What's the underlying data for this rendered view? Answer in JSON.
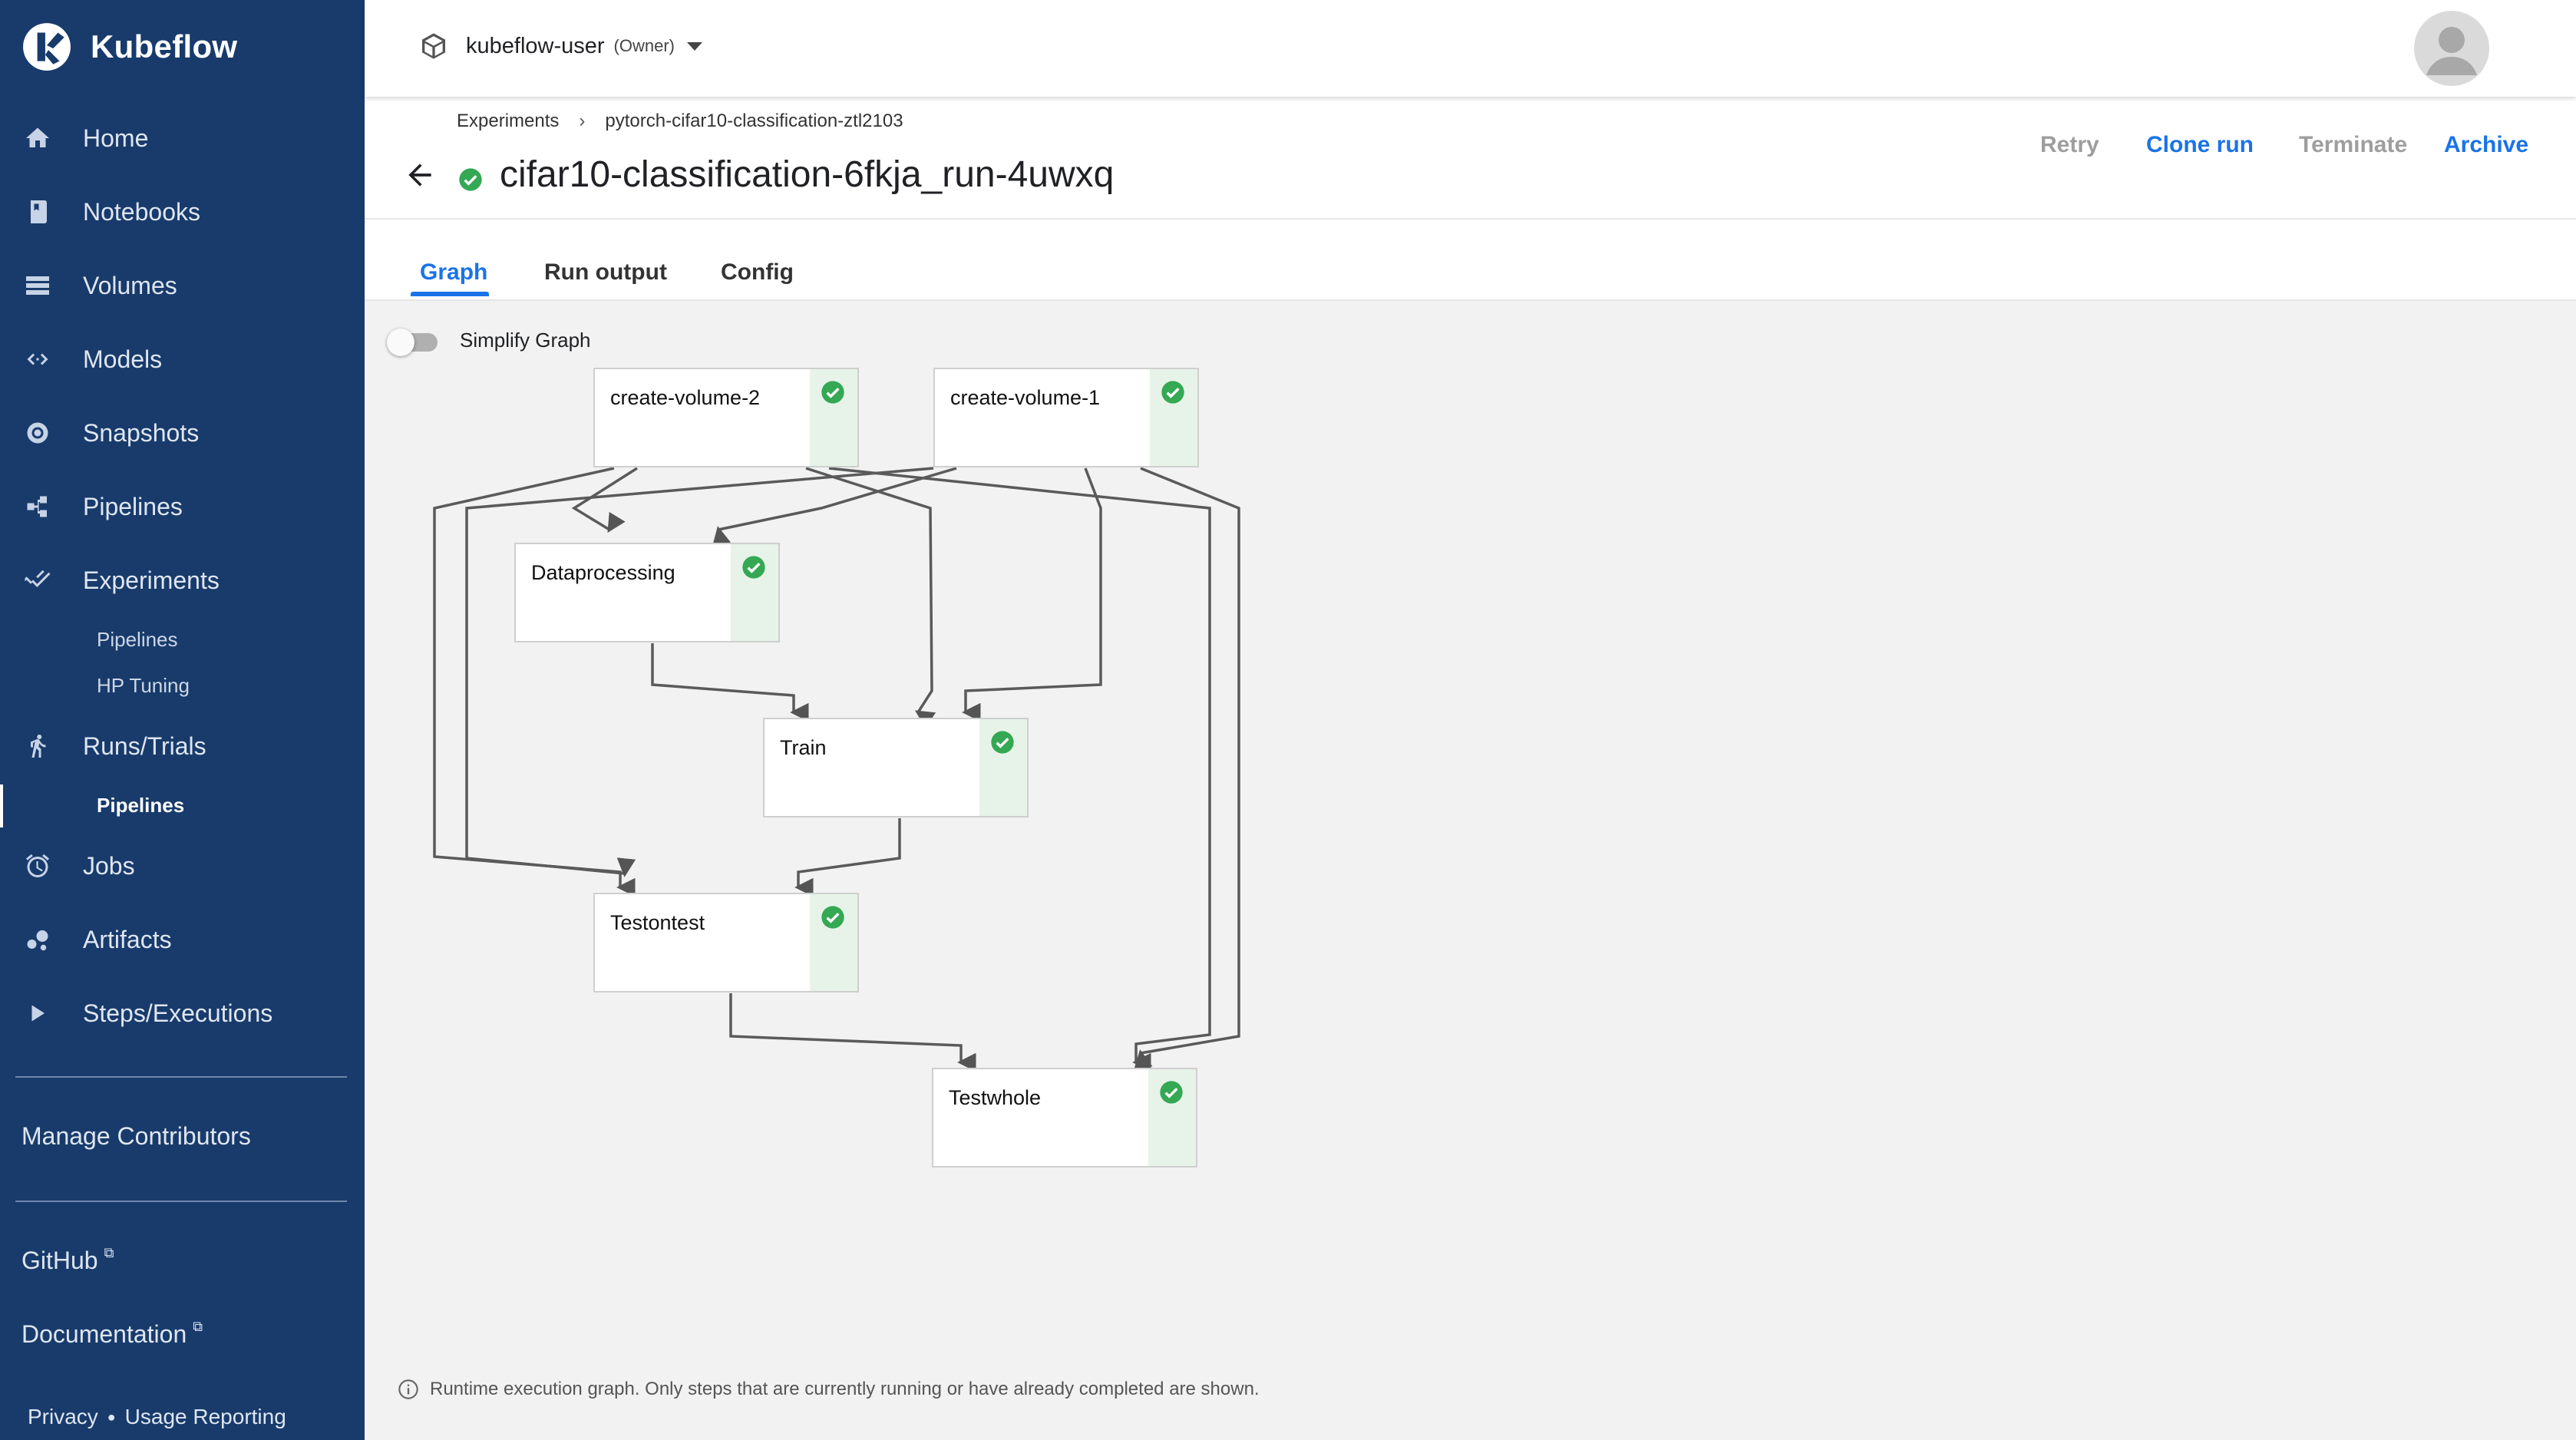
{
  "brand": {
    "name": "Kubeflow"
  },
  "sidebar": {
    "items": [
      {
        "label": "Home",
        "icon": "home-icon"
      },
      {
        "label": "Notebooks",
        "icon": "notebook-icon"
      },
      {
        "label": "Volumes",
        "icon": "volumes-icon"
      },
      {
        "label": "Models",
        "icon": "models-icon"
      },
      {
        "label": "Snapshots",
        "icon": "snapshots-icon"
      },
      {
        "label": "Pipelines",
        "icon": "pipelines-icon"
      },
      {
        "label": "Experiments",
        "icon": "experiments-icon"
      },
      {
        "label": "Runs/Trials",
        "icon": "runs-icon"
      },
      {
        "label": "Jobs",
        "icon": "alarm-icon"
      },
      {
        "label": "Artifacts",
        "icon": "artifacts-icon"
      },
      {
        "label": "Steps/Executions",
        "icon": "play-icon"
      }
    ],
    "experiments_sub": [
      "Pipelines",
      "HP Tuning"
    ],
    "runs_sub": [
      "Pipelines"
    ],
    "manage_contributors": "Manage Contributors",
    "github": "GitHub",
    "documentation": "Documentation",
    "privacy": "Privacy",
    "usage_reporting": "Usage Reporting"
  },
  "header": {
    "namespace": "kubeflow-user",
    "role": "(Owner)"
  },
  "page": {
    "breadcrumb": [
      "Experiments",
      "pytorch-cifar10-classification-ztl2103"
    ],
    "breadcrumb_separator": "›",
    "title": "cifar10-classification-6fkja_run-4uwxq",
    "actions": {
      "retry": "Retry",
      "clone_run": "Clone run",
      "terminate": "Terminate",
      "archive": "Archive"
    },
    "tabs": [
      "Graph",
      "Run output",
      "Config"
    ]
  },
  "graph": {
    "simplify_label": "Simplify Graph",
    "simplify_enabled": false,
    "nodes": [
      {
        "label": "create-volume-2",
        "status": "succeeded"
      },
      {
        "label": "create-volume-1",
        "status": "succeeded"
      },
      {
        "label": "Dataprocessing",
        "status": "succeeded"
      },
      {
        "label": "Train",
        "status": "succeeded"
      },
      {
        "label": "Testontest",
        "status": "succeeded"
      },
      {
        "label": "Testwhole",
        "status": "succeeded"
      }
    ],
    "footer_note": "Runtime execution graph. Only steps that are currently running or have already completed are shown."
  },
  "colors": {
    "sidebar_bg": "#183b6c",
    "accent": "#1a73e8",
    "success": "#34a853",
    "status_bg": "#e7f3e8",
    "disabled_action": "#9e9e9e"
  }
}
